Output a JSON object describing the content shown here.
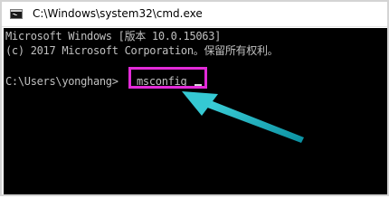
{
  "window": {
    "title": "C:\\Windows\\system32\\cmd.exe"
  },
  "console": {
    "line1": "Microsoft Windows [版本 10.0.15063]",
    "line2": "(c) 2017 Microsoft Corporation。保留所有权利。",
    "prompt": "C:\\Users\\yonghang>",
    "command": "msconfig"
  },
  "annotation": {
    "highlight_color": "#e22bd8",
    "arrow_color": "#29c6cf"
  },
  "icons": {
    "title_icon": "cmd-console-icon"
  }
}
